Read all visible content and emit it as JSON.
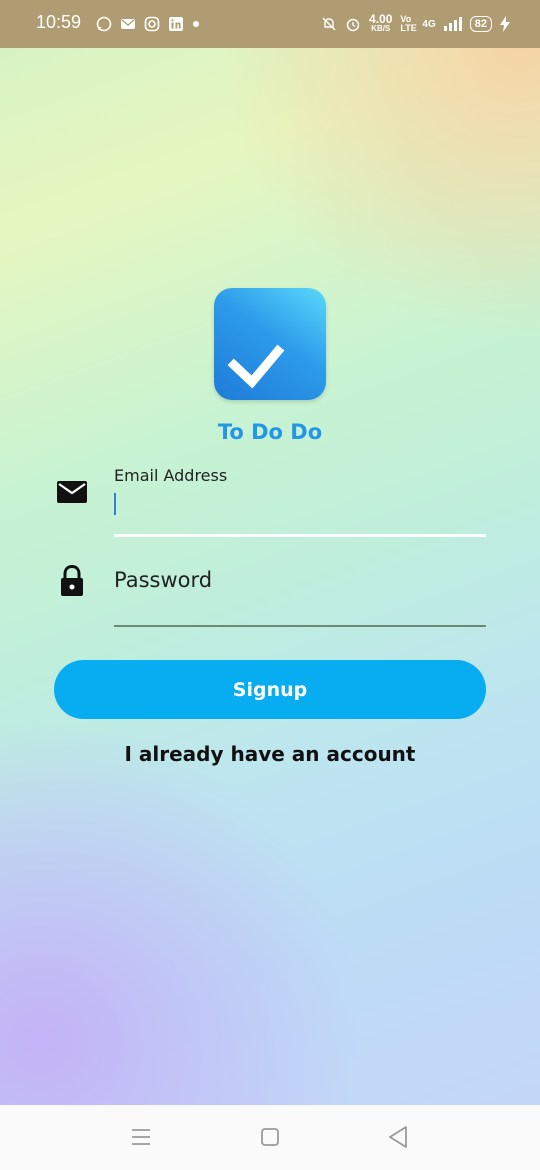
{
  "status_bar": {
    "time": "10:59",
    "network_speed": "4.00",
    "network_speed_unit": "KB/S",
    "volte_label": "Vo LTE",
    "network_type": "4G",
    "battery": "82"
  },
  "app": {
    "title": "To Do Do"
  },
  "form": {
    "email_label": "Email Address",
    "email_value": "",
    "password_placeholder": "Password",
    "signup_label": "Signup",
    "login_link": "I already have an account"
  },
  "colors": {
    "accent": "#07acf1",
    "title": "#2596e5",
    "status_bar": "#b09c72"
  },
  "icons": [
    "whatsapp-icon",
    "messages-icon",
    "instagram-icon",
    "linkedin-icon",
    "mute-icon",
    "alarm-icon",
    "signal-icon",
    "battery-icon",
    "charging-icon",
    "mail-icon",
    "lock-icon",
    "check-icon",
    "menu-icon",
    "home-icon",
    "back-icon"
  ]
}
